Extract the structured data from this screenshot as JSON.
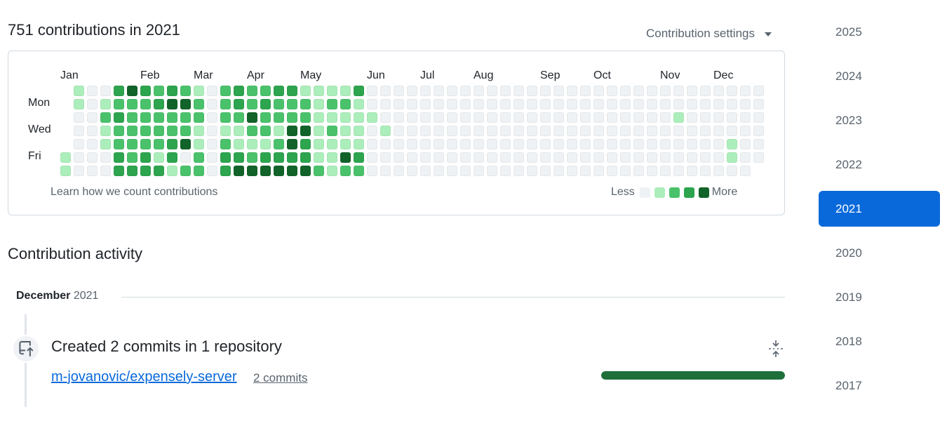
{
  "header": {
    "title": "751 contributions in 2021",
    "settings_label": "Contribution settings",
    "settings_icon": "triangle-down-icon"
  },
  "graph": {
    "months": [
      "Jan",
      "Feb",
      "Mar",
      "Apr",
      "May",
      "Jun",
      "Jul",
      "Aug",
      "Sep",
      "Oct",
      "Nov",
      "Dec"
    ],
    "day_labels": [
      "Mon",
      "Wed",
      "Fri"
    ],
    "colors": [
      "#eff2f5",
      "#aceebb",
      "#4ac26b",
      "#2da44e",
      "#116329"
    ],
    "grid_note": "rows Sun..Sat; each string is one week column; digit = contribution level 0-4; '-' = outside year",
    "weeks": [
      "-----11",
      "1100000",
      "0000000",
      "0121100",
      "3232233",
      "4222223",
      "3222233",
      "2322213",
      "3422331",
      "2422402",
      "1221122",
      "0000000",
      "2221233",
      "3321134",
      "2242124",
      "2322134",
      "3221234",
      "3224434",
      "1224334",
      "1111112",
      "1212111",
      "1211142",
      "3111132",
      "0010000",
      "0001000",
      "0000000",
      "0000000",
      "0000000",
      "0000000",
      "0000000",
      "0000000",
      "0000000",
      "0000000",
      "0000000",
      "0000000",
      "0000000",
      "0000000",
      "0000000",
      "0000000",
      "0000000",
      "0000000",
      "0000000",
      "0000000",
      "0000000",
      "0000000",
      "0000000",
      "0010000",
      "0000000",
      "0000000",
      "0000000",
      "0000110",
      "0000000",
      "000000-"
    ],
    "learn_link": "Learn how we count contributions",
    "legend_less": "Less",
    "legend_more": "More"
  },
  "activity": {
    "title": "Contribution activity",
    "month_label": "December",
    "month_year": "2021",
    "event_icon": "repo-push-icon",
    "collapse_icon": "fold-icon",
    "event_title": "Created 2 commits in 1 repository",
    "repo_name": "m-jovanovic/expensely-server",
    "commits_label": "2 commits",
    "progress_fraction": 1.0
  },
  "years": [
    "2025",
    "2024",
    "2023",
    "2022",
    "2021",
    "2020",
    "2019",
    "2018",
    "2017"
  ],
  "selected_year": "2021"
}
